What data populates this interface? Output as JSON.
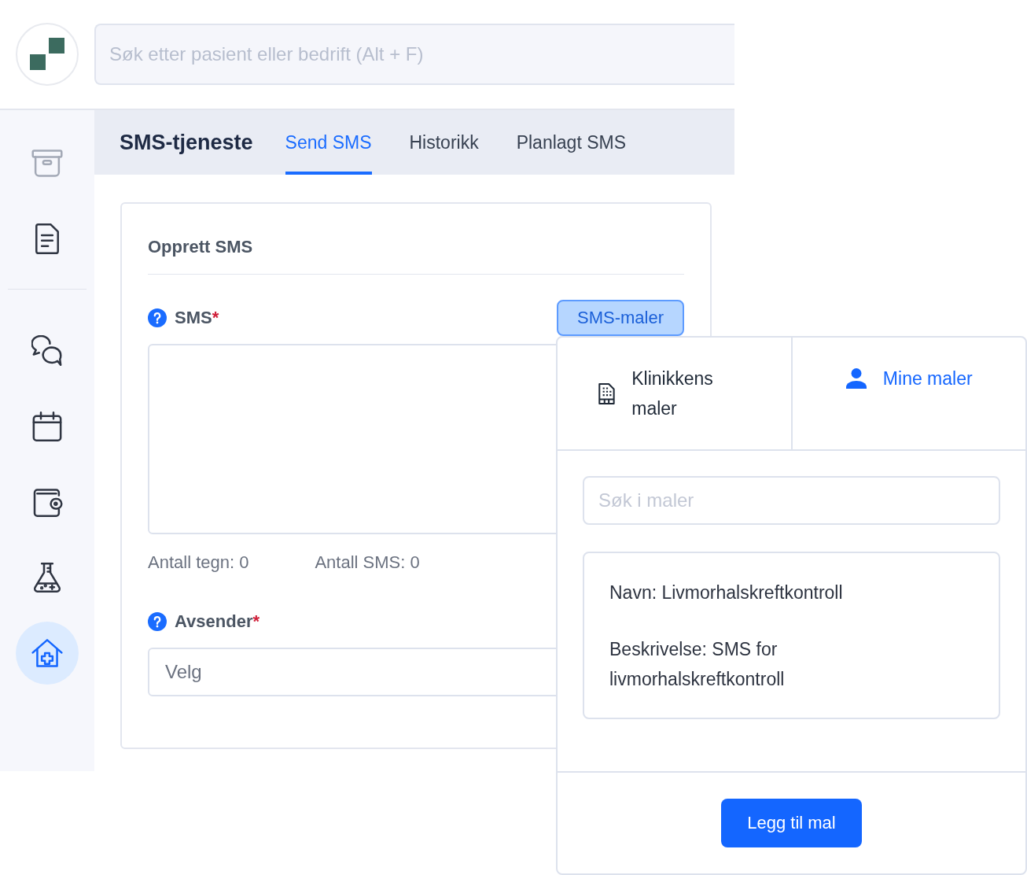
{
  "top_bar": {
    "search": {
      "placeholder": "Søk etter pasient eller bedrift (Alt + F)"
    }
  },
  "sidebar": {
    "groups": [
      {
        "items": [
          {
            "kind": "archive",
            "selected": false,
            "disabled": true
          },
          {
            "kind": "document",
            "selected": false,
            "disabled": false
          }
        ]
      },
      {
        "items": [
          {
            "kind": "chat",
            "selected": false,
            "disabled": false
          },
          {
            "kind": "calendar",
            "selected": false,
            "disabled": false
          },
          {
            "kind": "wallet",
            "selected": false,
            "disabled": false
          },
          {
            "kind": "flask",
            "selected": false,
            "disabled": false
          },
          {
            "kind": "clinic",
            "selected": true,
            "disabled": false
          }
        ]
      }
    ]
  },
  "header": {
    "title": "SMS-tjeneste",
    "tabs": [
      {
        "label": "Send SMS",
        "selected": true
      },
      {
        "label": "Historikk",
        "selected": false
      },
      {
        "label": "Planlagt SMS",
        "selected": false
      }
    ]
  },
  "form": {
    "title": "Opprett SMS",
    "fields": [
      {
        "kind": "textarea",
        "label": "SMS",
        "required_mark": "*",
        "help": true,
        "button": {
          "label": "SMS-maler",
          "active": true
        },
        "counters": [
          "Antall tegn: 0",
          "Antall SMS: 0"
        ]
      },
      {
        "kind": "select",
        "label": "Avsender",
        "required_mark": "*",
        "help": true,
        "placeholder": "Velg"
      }
    ]
  },
  "templates_popover": {
    "tabs": [
      {
        "kind": "clinic",
        "label": "Klinikkens maler",
        "selected": false
      },
      {
        "kind": "personal",
        "label": "Mine maler",
        "selected": true
      }
    ],
    "search": {
      "placeholder": "Søk i maler"
    },
    "templates": [
      {
        "name": "Navn: Livmorhalskreftkontroll",
        "description": "Beskrivelse: SMS for livmorhalskreftkontroll"
      }
    ],
    "button": "Legg til mal"
  }
}
